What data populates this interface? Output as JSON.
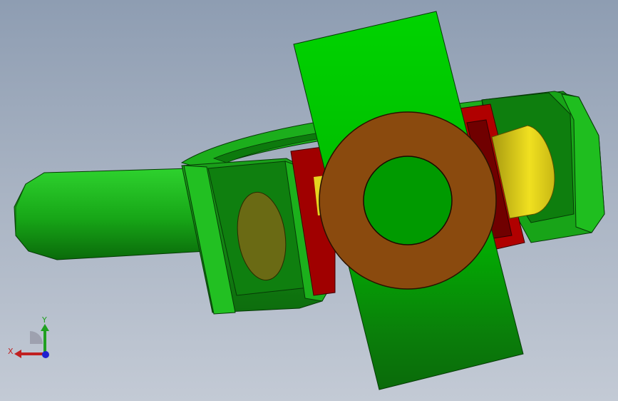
{
  "viewport": {
    "view": "3D model view"
  },
  "model": {
    "parts": [
      {
        "id": "shaft",
        "color": "#1fb21f"
      },
      {
        "id": "yoke-housing",
        "color": "#169a16"
      },
      {
        "id": "cross-plate",
        "color": "#00cc00"
      },
      {
        "id": "bronze-washer",
        "color": "#8a4a0e"
      },
      {
        "id": "seal-ring",
        "color": "#a00000"
      },
      {
        "id": "pin",
        "color": "#e0d000"
      }
    ]
  },
  "triad": {
    "x_label": "X",
    "y_label": "Y",
    "x_color": "#c02020",
    "y_color": "#20a020",
    "z_color": "#2020d0"
  }
}
